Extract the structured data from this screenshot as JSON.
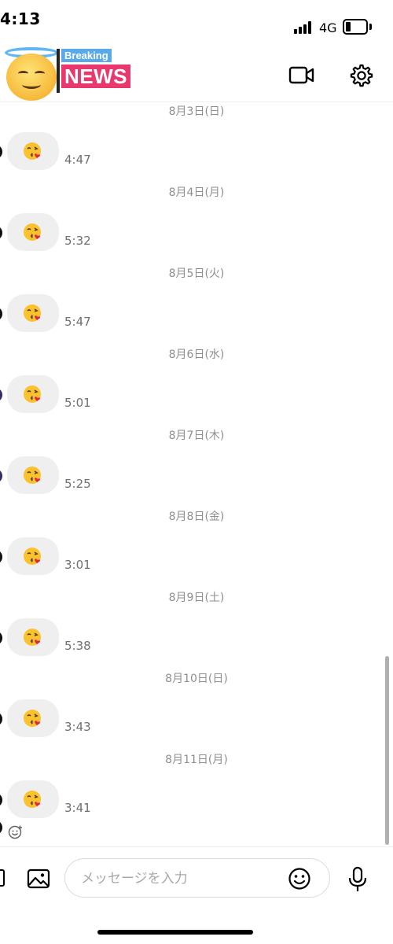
{
  "status_bar": {
    "time": "4:13",
    "network": "4G",
    "battery_level": 0.25
  },
  "header": {
    "avatar_badge_top": "Breaking",
    "avatar_badge_bottom": "NEWS",
    "icons": [
      "video-camera-icon",
      "gear-icon"
    ]
  },
  "thread": {
    "entries": [
      {
        "date": "8月3日(日)",
        "time": "4:47",
        "avatar": "dark"
      },
      {
        "date": "8月4日(月)",
        "time": "5:32",
        "avatar": "dark"
      },
      {
        "date": "8月5日(火)",
        "time": "5:47",
        "avatar": "dark"
      },
      {
        "date": "8月6日(水)",
        "time": "5:01",
        "avatar": "purple"
      },
      {
        "date": "8月7日(木)",
        "time": "5:25",
        "avatar": "purple"
      },
      {
        "date": "8月8日(金)",
        "time": "3:01",
        "avatar": "dark"
      },
      {
        "date": "8月9日(土)",
        "time": "5:38",
        "avatar": "dark"
      },
      {
        "date": "8月10日(日)",
        "time": "3:43",
        "avatar": "dark"
      },
      {
        "date": "8月11日(月)",
        "time": "3:41",
        "avatar": "dark"
      }
    ],
    "message_emoji": "face-blowing-a-kiss"
  },
  "composer": {
    "placeholder": "メッセージを入力",
    "icons": [
      "gallery-icon",
      "sticker-icon",
      "microphone-icon"
    ]
  },
  "colors": {
    "bubble": "#efefef",
    "meta_text": "#8e8e8e",
    "badge_blue": "#5aa9e8",
    "badge_pink": "#e8386d"
  }
}
